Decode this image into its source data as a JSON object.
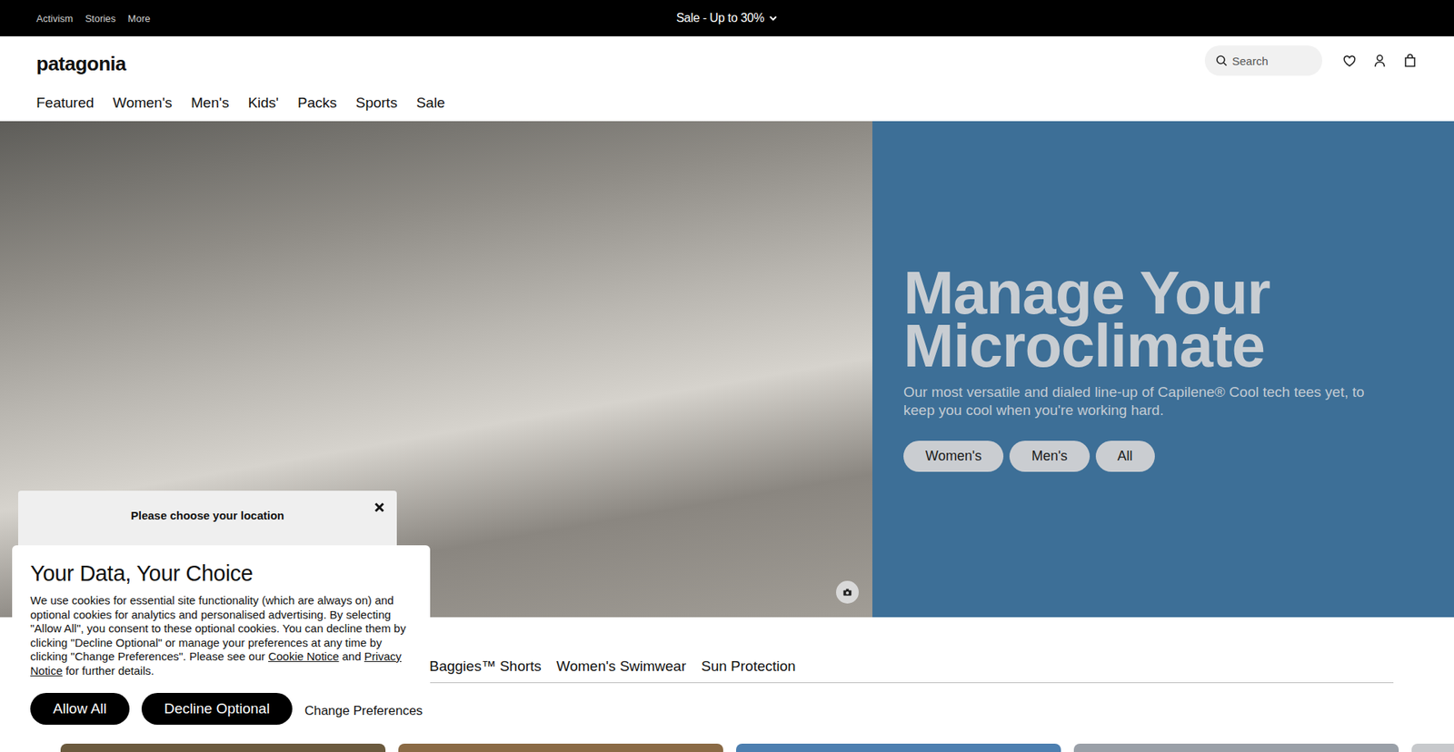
{
  "utility_bar": {
    "links": [
      "Activism",
      "Stories",
      "More"
    ],
    "promo": "Sale - Up to 30%"
  },
  "header": {
    "logo": "patagonia",
    "search": {
      "placeholder": "Search"
    }
  },
  "nav": [
    "Featured",
    "Women's",
    "Men's",
    "Kids'",
    "Packs",
    "Sports",
    "Sale"
  ],
  "hero": {
    "title_lines": [
      "Manage Your",
      "Microclimate"
    ],
    "text": "Our most versatile and dialed line-up of Capilene® Cool tech tees yet, to keep you cool when you're working hard.",
    "buttons": [
      "Women's",
      "Men's",
      "All"
    ]
  },
  "category_tabs": [
    "Baggies™ Shorts",
    "Women's Swimwear",
    "Sun Protection"
  ],
  "location_popup": {
    "title": "Please choose your location"
  },
  "cookie_modal": {
    "title": "Your Data, Your Choice",
    "body_before": "We use cookies for essential site functionality (which are always on) and optional cookies for analytics and personalised advertising. By selecting \"Allow All\", you consent to these optional cookies. You can decline them by clicking \"Decline Optional\" or manage your preferences at any time by clicking \"Change Preferences\". Please see our ",
    "link_1": "Cookie Notice",
    "body_middle": " and ",
    "link_2": "Privacy Notice",
    "body_after": " for further details.",
    "buttons": [
      "Allow All",
      "Decline Optional"
    ],
    "link_button": "Change Preferences"
  }
}
